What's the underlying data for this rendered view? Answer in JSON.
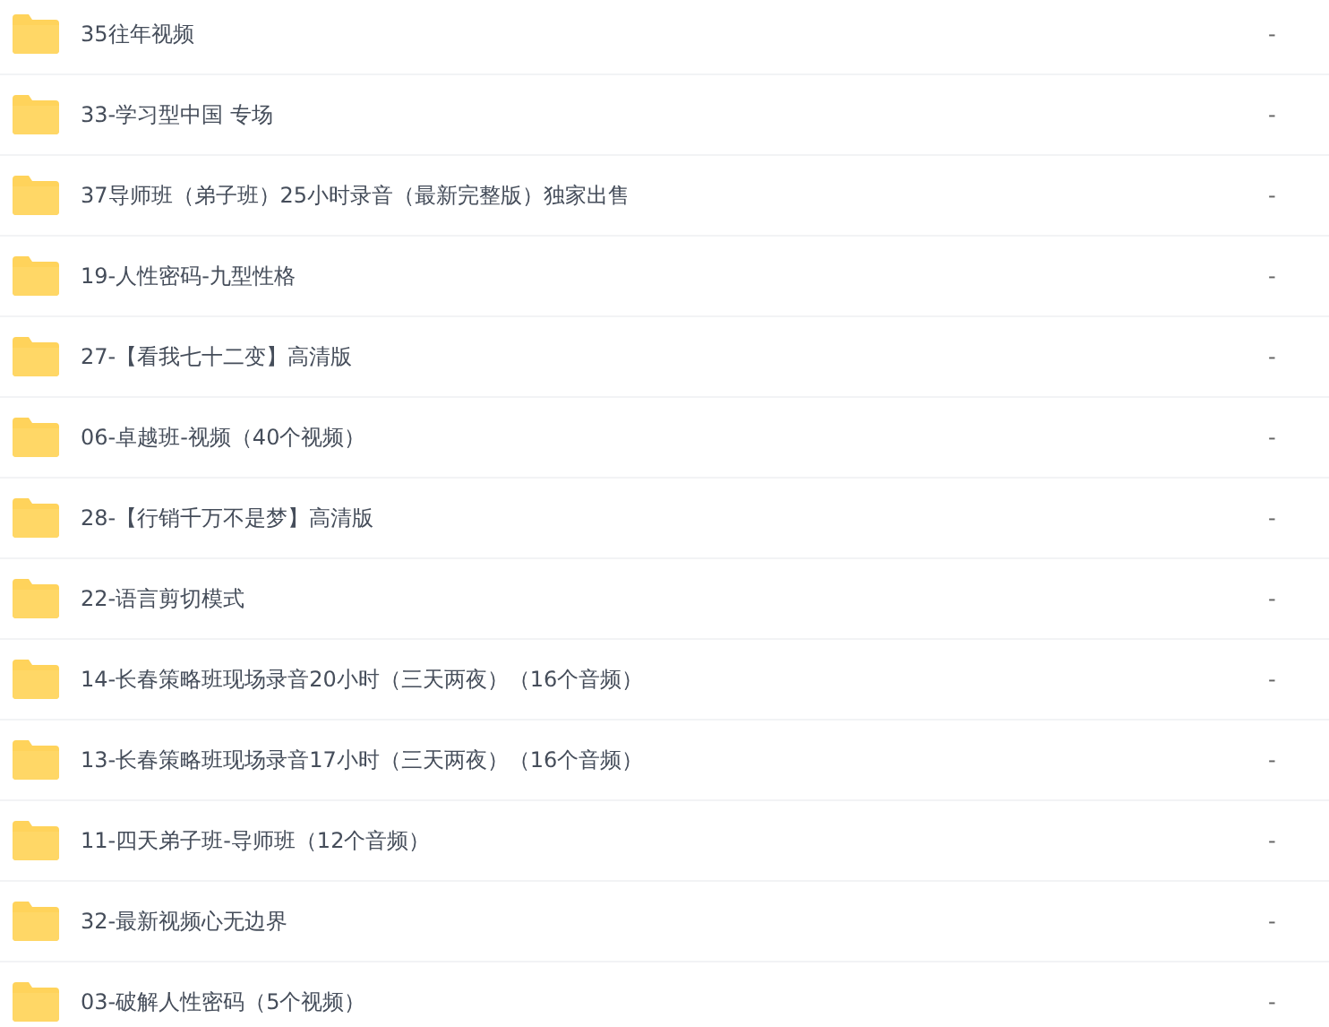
{
  "files": [
    {
      "name": "35往年视频",
      "size": "-"
    },
    {
      "name": "33-学习型中国 专场",
      "size": "-"
    },
    {
      "name": "37导师班（弟子班）25小时录音（最新完整版）独家出售",
      "size": "-"
    },
    {
      "name": "19-人性密码-九型性格",
      "size": "-"
    },
    {
      "name": "27-【看我七十二变】高清版",
      "size": "-"
    },
    {
      "name": "06-卓越班-视频（40个视频）",
      "size": "-"
    },
    {
      "name": "28-【行销千万不是梦】高清版",
      "size": "-"
    },
    {
      "name": "22-语言剪切模式",
      "size": "-"
    },
    {
      "name": "14-长春策略班现场录音20小时（三天两夜）（16个音频）",
      "size": "-"
    },
    {
      "name": "13-长春策略班现场录音17小时（三天两夜）（16个音频）",
      "size": "-"
    },
    {
      "name": "11-四天弟子班-导师班（12个音频）",
      "size": "-"
    },
    {
      "name": "32-最新视频心无边界",
      "size": "-"
    },
    {
      "name": "03-破解人性密码（5个视频）",
      "size": "-"
    }
  ]
}
